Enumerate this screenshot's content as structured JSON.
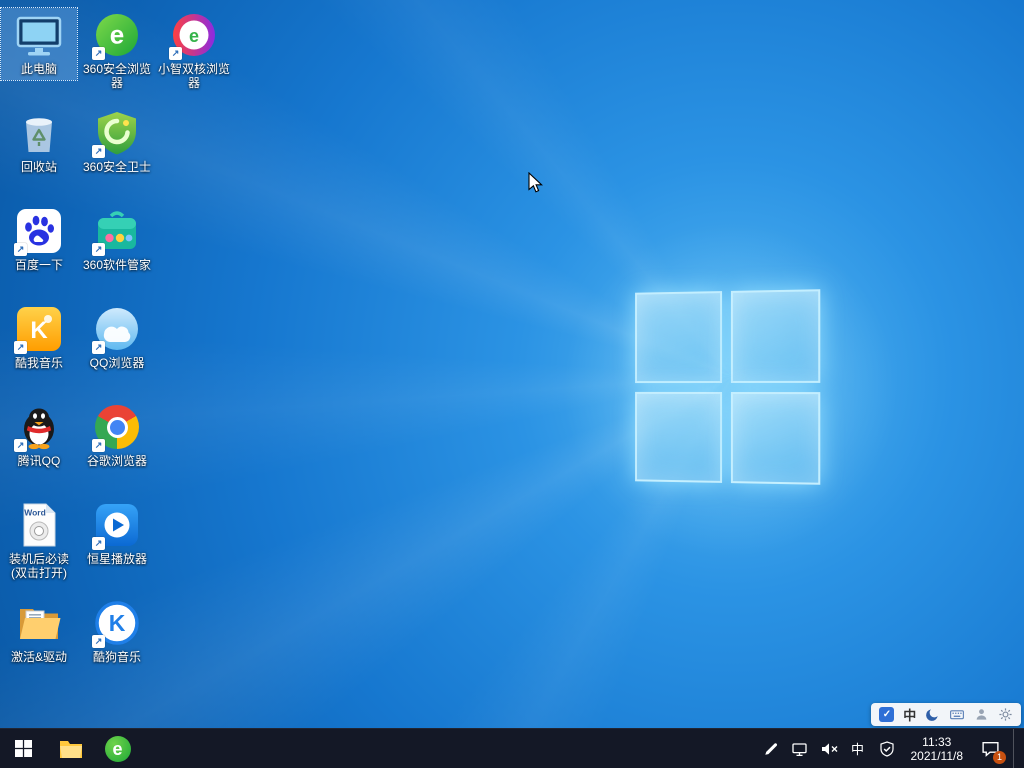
{
  "desktop": {
    "icons": [
      {
        "label": "此电脑",
        "icon": "this-pc-icon",
        "selected": true,
        "shortcut_arrow": false
      },
      {
        "label": "回收站",
        "icon": "recycle-bin-icon",
        "selected": false,
        "shortcut_arrow": false
      },
      {
        "label": "百度一下",
        "icon": "baidu-icon",
        "selected": false,
        "shortcut_arrow": true
      },
      {
        "label": "酷我音乐",
        "icon": "kuwo-music-icon",
        "selected": false,
        "shortcut_arrow": true
      },
      {
        "label": "腾讯QQ",
        "icon": "tencent-qq-icon",
        "selected": false,
        "shortcut_arrow": true
      },
      {
        "label": "装机后必读(双击打开)",
        "icon": "word-document-icon",
        "selected": false,
        "shortcut_arrow": false
      },
      {
        "label": "激活&驱动",
        "icon": "folder-icon",
        "selected": false,
        "shortcut_arrow": false
      },
      {
        "label": "360安全浏览器",
        "icon": "360-browser-icon",
        "selected": false,
        "shortcut_arrow": true
      },
      {
        "label": "360安全卫士",
        "icon": "360-safeguard-shield-icon",
        "selected": false,
        "shortcut_arrow": true
      },
      {
        "label": "360软件管家",
        "icon": "360-software-manager-icon",
        "selected": false,
        "shortcut_arrow": true
      },
      {
        "label": "QQ浏览器",
        "icon": "qq-browser-icon",
        "selected": false,
        "shortcut_arrow": true
      },
      {
        "label": "谷歌浏览器",
        "icon": "chrome-icon",
        "selected": false,
        "shortcut_arrow": true
      },
      {
        "label": "恒星播放器",
        "icon": "star-player-icon",
        "selected": false,
        "shortcut_arrow": true
      },
      {
        "label": "酷狗音乐",
        "icon": "kugou-music-icon",
        "selected": false,
        "shortcut_arrow": true
      },
      {
        "label": "小智双核浏览器",
        "icon": "xiaozhi-browser-icon",
        "selected": false,
        "shortcut_arrow": true
      }
    ],
    "shortcut_arrow_glyph": "↗"
  },
  "taskbar": {
    "buttons": [
      {
        "icon": "start-icon"
      },
      {
        "icon": "file-explorer-icon"
      },
      {
        "icon": "360-browser-icon"
      }
    ]
  },
  "tray": {
    "icons": [
      "pen-icon",
      "network-icon",
      "volume-muted-icon",
      "ime-language-icon",
      "security-shield-check-icon"
    ],
    "ime_indicator": "中",
    "time": "11:33",
    "date": "2021/11/8",
    "notification_badge": "1"
  },
  "ime_bar": {
    "logo_glyph": "✓",
    "mode_label": "中",
    "icons": [
      "ime-logo-icon",
      "chinese-mode-indicator",
      "moon-icon",
      "keyboard-icon",
      "user-icon",
      "settings-gear-icon"
    ]
  },
  "colors": {
    "wallpaper_center": "#54b6f2",
    "wallpaper_edge": "#0a58a4",
    "taskbar_bg": "#141826",
    "selection_highlight": "rgba(115,170,225,0.40)",
    "badge": "#c75010"
  }
}
